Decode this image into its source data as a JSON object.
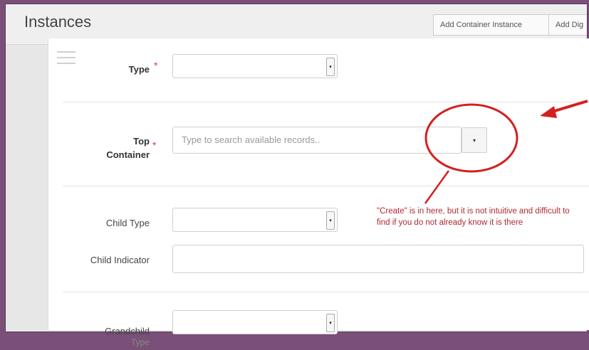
{
  "header": {
    "title": "Instances",
    "buttons": [
      "Add Container Instance",
      "Add Dig"
    ]
  },
  "form": {
    "type_label": "Type",
    "top_container_label_line1": "Top",
    "top_container_label_line2": "Container",
    "top_container_placeholder": "Type to search available records..",
    "child_type_label": "Child Type",
    "child_indicator_label": "Child Indicator",
    "grandchild_label_line1": "Grandchild",
    "grandchild_label_line2": "Type",
    "required_mark": "*"
  },
  "annotation": {
    "note": "\"Create\" is in here, but it is not intuitive and difficult to find if you do not already know it is there",
    "color": "#c62828"
  },
  "icons": {
    "caret": "▾",
    "drag": "drag-handle-icon"
  }
}
